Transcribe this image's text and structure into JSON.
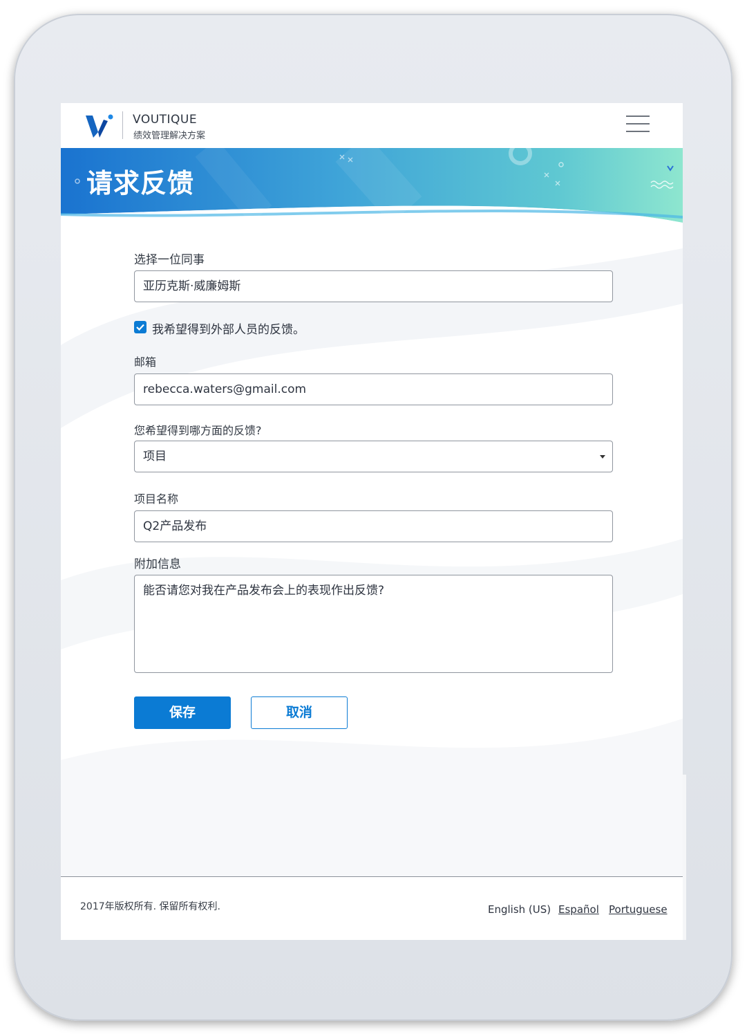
{
  "brand": {
    "name": "VOUTIQUE",
    "tagline": "绩效管理解决方案"
  },
  "banner": {
    "title": "请求反馈"
  },
  "form": {
    "colleague": {
      "label": "选择一位同事",
      "value": "亚历克斯·威廉姆斯"
    },
    "external": {
      "checked": true,
      "label": "我希望得到外部人员的反馈。"
    },
    "email": {
      "label": "邮箱",
      "value": "rebecca.waters@gmail.com"
    },
    "feedback_type": {
      "label": "您希望得到哪方面的反馈?",
      "value": "项目"
    },
    "project_name": {
      "label": "项目名称",
      "value": "Q2产品发布"
    },
    "additional_info": {
      "label": "附加信息",
      "value": "能否请您对我在产品发布会上的表现作出反馈?"
    },
    "save_label": "保存",
    "cancel_label": "取消"
  },
  "footer": {
    "copyright": "2017年版权所有. 保留所有权利.",
    "languages": [
      "English (US)",
      "Español",
      "Portuguese"
    ]
  },
  "colors": {
    "primary": "#0b7bd4",
    "banner_start": "#1a73d0",
    "banner_end": "#8ee6cf"
  },
  "icons": [
    "logo-icon",
    "menu-icon",
    "checkmark-icon",
    "chevron-down-icon"
  ]
}
